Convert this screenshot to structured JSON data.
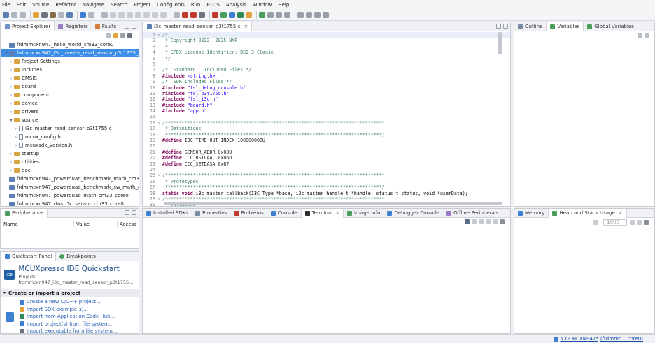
{
  "menu": [
    "File",
    "Edit",
    "Source",
    "Refactor",
    "Navigate",
    "Search",
    "Project",
    "ConfigTools",
    "Run",
    "RTOS",
    "Analysis",
    "Window",
    "Help"
  ],
  "explorer": {
    "tabs": [
      "Project Explorer",
      "Registers",
      "Faults"
    ],
    "items": [
      {
        "label": "frdmmcxn947_hello_world_cm33_core0",
        "indent": 0,
        "arrow": "",
        "icon": "proj",
        "selected": false
      },
      {
        "label": "frdmmcxn947_i3c_master_read_sensor_p3t1755_cm33_core0",
        "indent": 0,
        "arrow": "▾",
        "icon": "proj",
        "selected": true
      },
      {
        "label": "Project Settings",
        "indent": 1,
        "arrow": "›",
        "icon": "folder",
        "selected": false
      },
      {
        "label": "Includes",
        "indent": 1,
        "arrow": "›",
        "icon": "folder",
        "selected": false
      },
      {
        "label": "CMSIS",
        "indent": 1,
        "arrow": "›",
        "icon": "folder",
        "selected": false
      },
      {
        "label": "board",
        "indent": 1,
        "arrow": "›",
        "icon": "folder",
        "selected": false
      },
      {
        "label": "component",
        "indent": 1,
        "arrow": "›",
        "icon": "folder",
        "selected": false
      },
      {
        "label": "device",
        "indent": 1,
        "arrow": "›",
        "icon": "folder",
        "selected": false
      },
      {
        "label": "drivers",
        "indent": 1,
        "arrow": "›",
        "icon": "folder",
        "selected": false
      },
      {
        "label": "source",
        "indent": 1,
        "arrow": "▾",
        "icon": "folder",
        "selected": false
      },
      {
        "label": "i3c_master_read_sensor_p3t1755.c",
        "indent": 2,
        "arrow": "›",
        "icon": "file",
        "selected": false
      },
      {
        "label": "mcux_config.h",
        "indent": 2,
        "arrow": "›",
        "icon": "file",
        "selected": false
      },
      {
        "label": "mcuxsdk_version.h",
        "indent": 2,
        "arrow": "›",
        "icon": "file",
        "selected": false
      },
      {
        "label": "startup",
        "indent": 1,
        "arrow": "›",
        "icon": "folder",
        "selected": false
      },
      {
        "label": "utilities",
        "indent": 1,
        "arrow": "›",
        "icon": "folder",
        "selected": false
      },
      {
        "label": "doc",
        "indent": 1,
        "arrow": "›",
        "icon": "folder",
        "selected": false
      },
      {
        "label": "frdmmcxn947_powerquad_benchmark_math_cm33_core0",
        "indent": 0,
        "arrow": "",
        "icon": "proj",
        "selected": false
      },
      {
        "label": "frdmmcxn947_powerquad_benchmark_sw_math_cm33_core0",
        "indent": 0,
        "arrow": "",
        "icon": "proj",
        "selected": false
      },
      {
        "label": "frdmmcxn947_powerquad_math_cm33_core0",
        "indent": 0,
        "arrow": "",
        "icon": "proj",
        "selected": false
      },
      {
        "label": "frdmmcxn947_rtos_i3c_sensor_cm33_core0",
        "indent": 0,
        "arrow": "",
        "icon": "proj",
        "selected": false
      }
    ]
  },
  "peripherals": {
    "tab": "Peripherals+",
    "columns": [
      "Name",
      "Value",
      "Access"
    ]
  },
  "quickstart": {
    "tabs": [
      "Quickstart Panel",
      "Breakpoints"
    ],
    "title": "MCUXpresso IDE Quickstart",
    "project": "Project: frdmmcxn947_i3c_master_read_sensor_p3t1755...",
    "section": "Create or import a project",
    "links": [
      "Create a new C/C++ project...",
      "Import SDK example(s)...",
      "Import from Application Code Hub...",
      "Import project(s) from file system...",
      "Import executable from file system..."
    ]
  },
  "editor": {
    "tab": "i3c_master_read_sensor_p3t1755.c",
    "lines": [
      {
        "n": "1",
        "t": "/*",
        "c": "cm",
        "fold": true
      },
      {
        "n": "2",
        "t": " * Copyright 2022, 2025 NXP",
        "c": "cm"
      },
      {
        "n": "3",
        "t": " *",
        "c": "cm"
      },
      {
        "n": "4",
        "t": " * SPDX-License-Identifier: BSD-3-Clause",
        "c": "cm"
      },
      {
        "n": "5",
        "t": " */",
        "c": "cm"
      },
      {
        "n": "6",
        "t": "",
        "c": ""
      },
      {
        "n": "7",
        "t": "/*  Standard C Included Files */",
        "c": "cm"
      },
      {
        "n": "8",
        "kw": "#include",
        "t": " <string.h>",
        "c": "st"
      },
      {
        "n": "9",
        "t": "/*  SDK Included Files */",
        "c": "cm"
      },
      {
        "n": "10",
        "kw": "#include",
        "t": " \"fsl_debug_console.h\"",
        "c": "st"
      },
      {
        "n": "11",
        "kw": "#include",
        "t": " \"fsl_p3t1755.h\"",
        "c": "st"
      },
      {
        "n": "12",
        "kw": "#include",
        "t": " \"fsl_i3c.h\"",
        "c": "st"
      },
      {
        "n": "13",
        "kw": "#include",
        "t": " \"board.h\"",
        "c": "st"
      },
      {
        "n": "14",
        "kw": "#include",
        "t": " \"app.h\"",
        "c": "st"
      },
      {
        "n": "15",
        "t": "",
        "c": ""
      },
      {
        "n": "16",
        "t": "/*******************************************************************************",
        "c": "cm",
        "fold": true
      },
      {
        "n": "17",
        "t": " * Definitions",
        "c": "cm"
      },
      {
        "n": "18",
        "t": " ******************************************************************************/",
        "c": "cm"
      },
      {
        "n": "19",
        "kw": "#define",
        "t": " I3C_TIME_OUT_INDEX 100000000U",
        "c": ""
      },
      {
        "n": "20",
        "t": "",
        "c": ""
      },
      {
        "n": "21",
        "kw": "#define",
        "t": " SENSOR_ADDR 0x08U",
        "c": ""
      },
      {
        "n": "22",
        "kw": "#define",
        "t": " CCC_RSTDAA  0x06U",
        "c": ""
      },
      {
        "n": "23",
        "kw": "#define",
        "t": " CCC_SETDASA 0x87",
        "c": ""
      },
      {
        "n": "24",
        "t": "",
        "c": ""
      },
      {
        "n": "25",
        "t": "/*******************************************************************************",
        "c": "cm",
        "fold": true
      },
      {
        "n": "26",
        "t": " * Prototypes",
        "c": "cm"
      },
      {
        "n": "27",
        "t": " ******************************************************************************/",
        "c": "cm"
      },
      {
        "n": "28",
        "kw": "static void",
        "t": " i3c_master_callback(I3C_Type *base, i3c_master_handle_t *handle, status_t status, void *userData);",
        "c": "",
        "bold": "i3c_master_callback"
      },
      {
        "n": "29",
        "t": "/*******************************************************************************",
        "c": "cm",
        "fold": true
      },
      {
        "n": "30",
        "t": " * Variables",
        "c": "cm"
      },
      {
        "n": "31",
        "t": " ******************************************************************************/",
        "c": "cm"
      }
    ]
  },
  "right_top": {
    "tabs": [
      "Outline",
      "Variables",
      "Global Variables"
    ]
  },
  "bottom": {
    "tabs": [
      "Installed SDKs",
      "Properties",
      "Problems",
      "Console",
      "Terminal",
      "Image Info",
      "Debugger Console",
      "Offline Peripherals"
    ],
    "active": "Terminal"
  },
  "memory": {
    "tabs": [
      "Memory",
      "Heap and Stack Usage"
    ],
    "zoom": "1000"
  },
  "status": {
    "text": "NXP MCXN947*",
    "link": "(frdmmc... core0)"
  },
  "colors": {
    "selection": "#3d8ee6",
    "link": "#2a63b8",
    "comment": "#3f7f5f",
    "keyword": "#7f0055",
    "string": "#2a00ff"
  }
}
